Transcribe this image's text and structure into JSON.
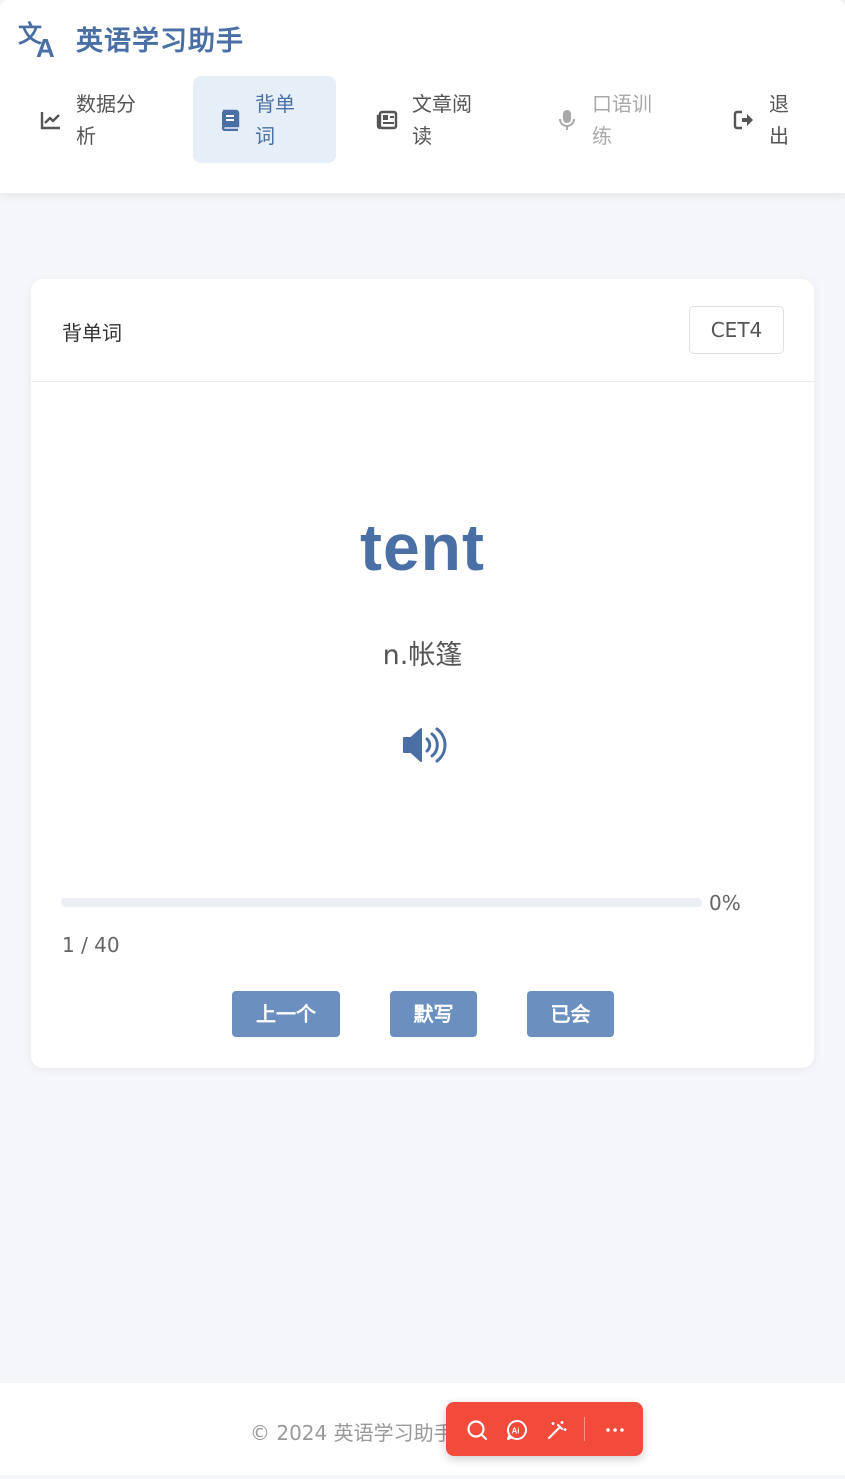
{
  "app": {
    "title": "英语学习助手"
  },
  "nav": {
    "items": [
      {
        "label": "数据分析",
        "icon": "chart-line-icon",
        "state": "normal"
      },
      {
        "label": "背单词",
        "icon": "book-icon",
        "state": "active"
      },
      {
        "label": "文章阅读",
        "icon": "newspaper-icon",
        "state": "normal"
      },
      {
        "label": "口语训练",
        "icon": "microphone-icon",
        "state": "disabled"
      },
      {
        "label": "退出",
        "icon": "logout-icon",
        "state": "normal"
      }
    ]
  },
  "card": {
    "title": "背单词",
    "level": "CET4",
    "word": "tent",
    "meaning": "n.帐篷",
    "speaker_icon": "volume-icon",
    "progress_percent": 0,
    "progress_text": "0%",
    "counter": "1 / 40",
    "buttons": {
      "prev": "上一个",
      "dictation": "默写",
      "known": "已会"
    }
  },
  "footer": {
    "copyright": "© 2024 英语学习助手"
  },
  "floating_toolbar": {
    "icons": [
      "search-icon",
      "ai-icon",
      "magic-wand-icon",
      "more-icon"
    ]
  },
  "colors": {
    "accent": "#4a6fa5",
    "button": "#6b8fbf",
    "active_nav_bg": "#e6eef8",
    "page_bg": "#f4f6fa",
    "floating_toolbar": "#f24a3b"
  }
}
